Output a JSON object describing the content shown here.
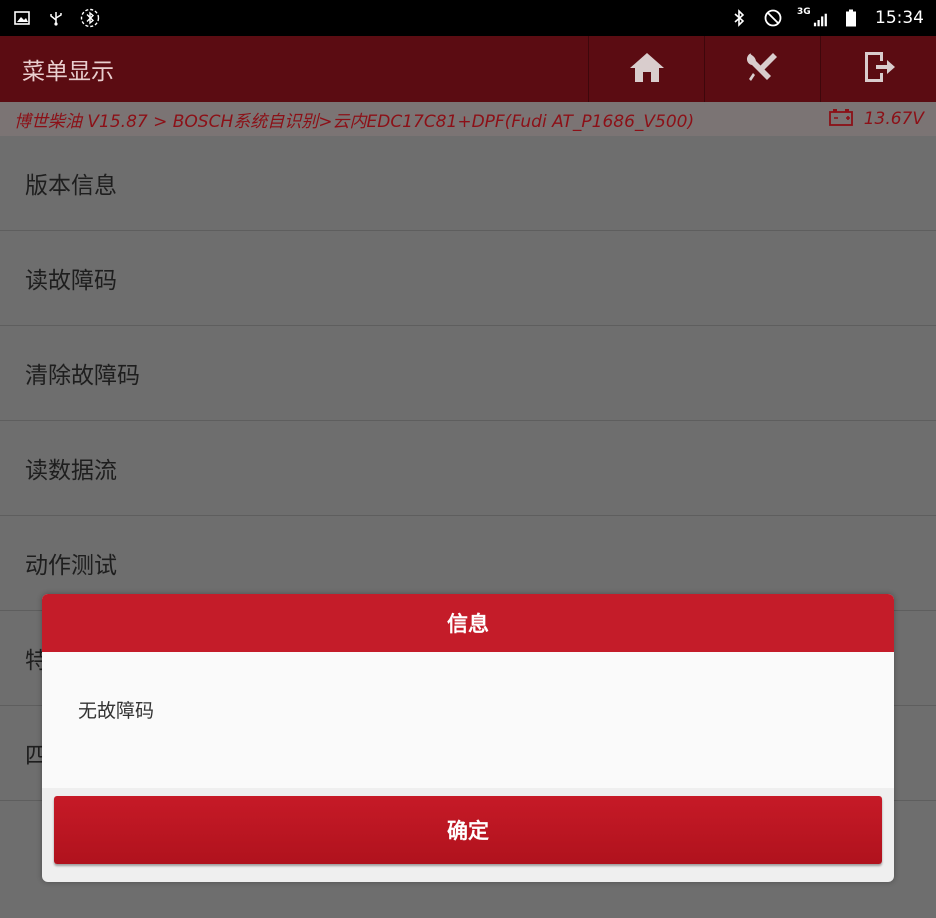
{
  "status_bar": {
    "time": "15:34",
    "network": "3G",
    "icons_left": [
      "image-icon",
      "usb-icon",
      "bluetooth-circle-icon"
    ],
    "icons_right": [
      "bluetooth-icon",
      "do-not-disturb-icon",
      "signal-icon",
      "battery-icon"
    ]
  },
  "header": {
    "title": "菜单显示",
    "buttons": [
      "home-icon",
      "diagnostic-tools-icon",
      "exit-icon"
    ]
  },
  "breadcrumb": {
    "path": "博世柴油 V15.87 > BOSCH系统自识别>云内EDC17C81+DPF(Fudi AT_P1686_V500)",
    "voltage": "13.67V"
  },
  "menu": {
    "items": [
      "版本信息",
      "读故障码",
      "清除故障码",
      "读数据流",
      "动作测试",
      "特",
      "四"
    ]
  },
  "dialog": {
    "title": "信息",
    "message": "无故障码",
    "ok_label": "确定"
  },
  "colors": {
    "header_bg": "#5b0c12",
    "accent_red": "#c41c29",
    "overlay_gray": "#6e6e6e"
  }
}
